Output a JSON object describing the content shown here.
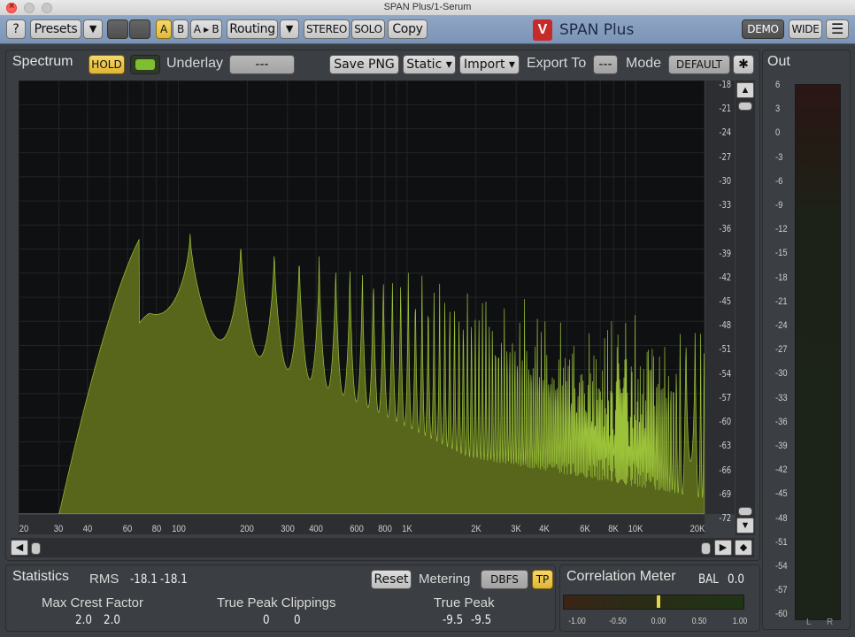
{
  "window": {
    "title": "SPAN Plus/1-Serum"
  },
  "toolbar": {
    "help": "?",
    "presets": "Presets",
    "dropdown": "▼",
    "a": "A",
    "b": "B",
    "a_to_b": "A ▸ B",
    "routing": "Routing",
    "stereo": "STEREO",
    "solo": "SOLO",
    "copy": "Copy",
    "brand_logo": "V",
    "brand_name": "SPAN Plus",
    "demo": "DEMO",
    "wide": "WIDE",
    "menu_icon": "☰"
  },
  "spectrum": {
    "tab": "Spectrum",
    "hold": "HOLD",
    "underlay_label": "Underlay",
    "underlay_value": "---",
    "save_png": "Save PNG",
    "static": "Static ▾",
    "import": "Import ▾",
    "export_label": "Export To",
    "export_value": "---",
    "mode_label": "Mode",
    "mode_value": "DEFAULT",
    "gear_icon": "✱",
    "db_ticks": [
      "-18",
      "-21",
      "-24",
      "-27",
      "-30",
      "-33",
      "-36",
      "-39",
      "-42",
      "-45",
      "-48",
      "-51",
      "-54",
      "-57",
      "-60",
      "-63",
      "-66",
      "-69",
      "-72"
    ],
    "freq_ticks": [
      "20",
      "30",
      "40",
      "60",
      "80",
      "100",
      "200",
      "300",
      "400",
      "600",
      "800",
      "1K",
      "2K",
      "3K",
      "4K",
      "6K",
      "8K",
      "10K",
      "20K"
    ]
  },
  "out": {
    "tab": "Out",
    "ticks": [
      "6",
      "3",
      "0",
      "-3",
      "-6",
      "-9",
      "-12",
      "-15",
      "-18",
      "-21",
      "-24",
      "-27",
      "-30",
      "-33",
      "-36",
      "-39",
      "-42",
      "-45",
      "-48",
      "-51",
      "-54",
      "-57",
      "-60"
    ],
    "l": "L",
    "r": "R"
  },
  "statistics": {
    "tab": "Statistics",
    "rms_label": "RMS",
    "rms_l": "-18.1",
    "rms_r": "-18.1",
    "reset": "Reset",
    "metering_label": "Metering",
    "metering_value": "DBFS",
    "tp": "TP",
    "crest_title": "Max Crest Factor",
    "crest_l": "2.0",
    "crest_r": "2.0",
    "clip_title": "True Peak Clippings",
    "clip_l": "0",
    "clip_r": "0",
    "peak_title": "True Peak",
    "peak_l": "-9.5",
    "peak_r": "-9.5"
  },
  "correlation": {
    "tab": "Correlation Meter",
    "bal_label": "BAL",
    "bal_value": "0.0",
    "ticks": [
      "-1.00",
      "-0.50",
      "0.00",
      "0.50",
      "1.00"
    ],
    "value": 0.0
  },
  "colors": {
    "spectrum_fill": "#5d6e1c",
    "spectrum_line": "#9cc23a",
    "accent_yellow": "#f0c84a"
  }
}
